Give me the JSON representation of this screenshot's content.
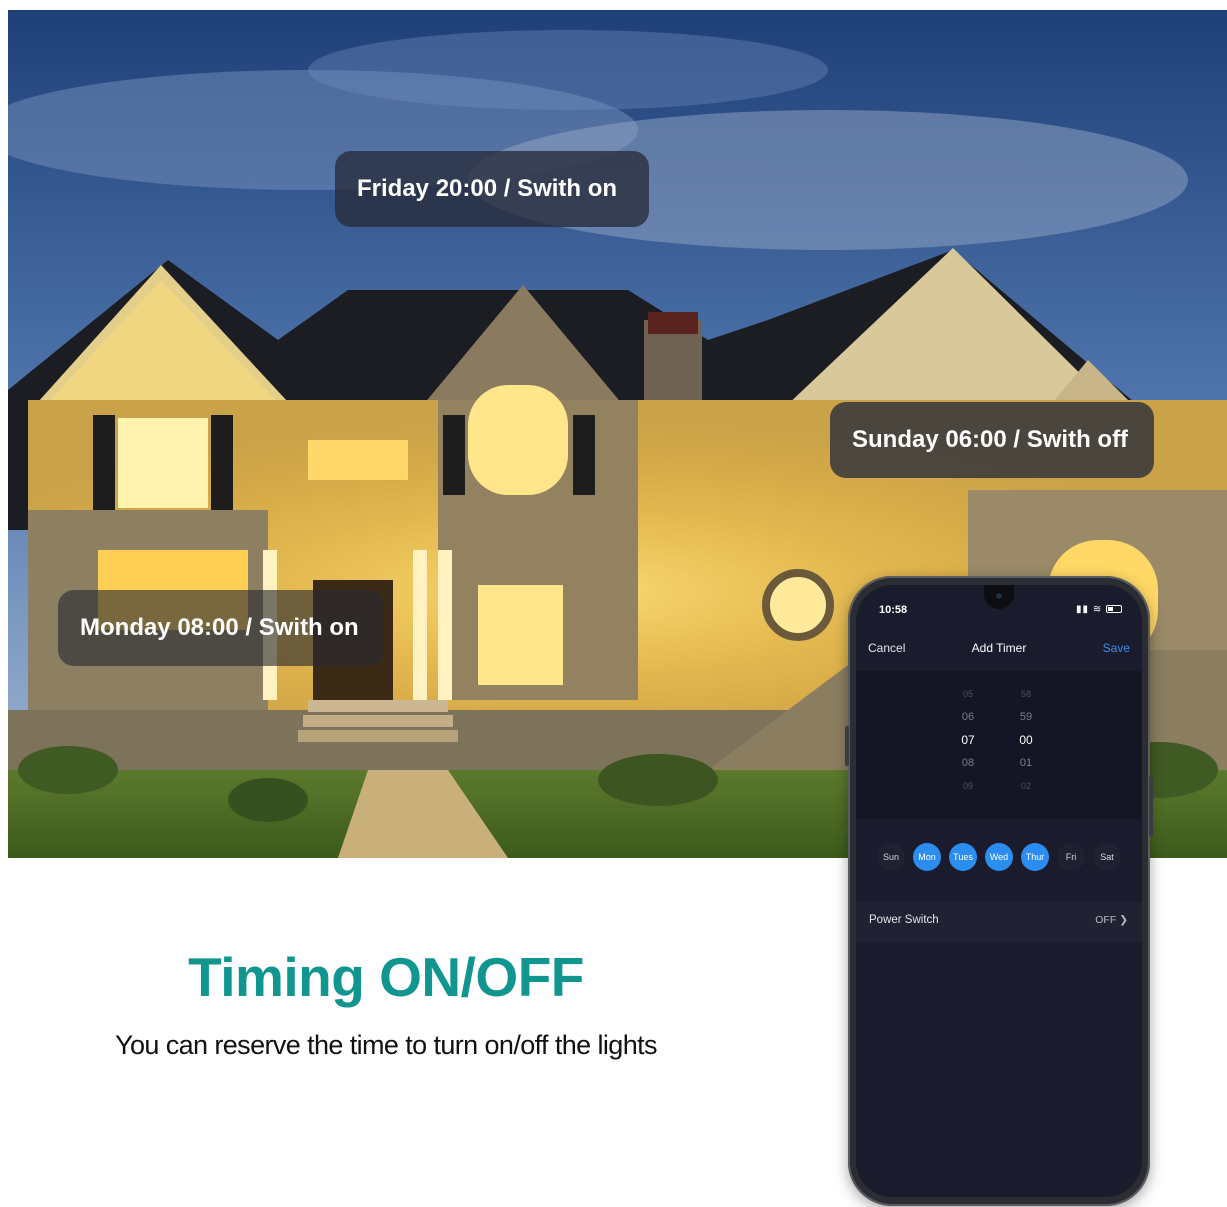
{
  "overlay_labels": {
    "friday": "Friday 20:00 / Swith on",
    "sunday": "Sunday 06:00 / Swith off",
    "monday": "Monday 08:00 / Swith on"
  },
  "headline": "Timing ON/OFF",
  "subline": "You can reserve the time to turn on/off the lights",
  "phone": {
    "status_time": "10:58",
    "nav": {
      "cancel": "Cancel",
      "title": "Add Timer",
      "save": "Save"
    },
    "picker": {
      "hours": [
        "05",
        "06",
        "07",
        "08",
        "09"
      ],
      "minutes": [
        "58",
        "59",
        "00",
        "01",
        "02"
      ],
      "selected_hour": "07",
      "selected_minute": "00"
    },
    "days": [
      {
        "label": "Sun",
        "selected": false
      },
      {
        "label": "Mon",
        "selected": true
      },
      {
        "label": "Tues",
        "selected": true
      },
      {
        "label": "Wed",
        "selected": true
      },
      {
        "label": "Thur",
        "selected": true
      },
      {
        "label": "Fri",
        "selected": false
      },
      {
        "label": "Sat",
        "selected": false
      }
    ],
    "power_switch": {
      "label": "Power Switch",
      "value": "OFF",
      "chevron": "chevron-right-icon"
    }
  },
  "colors": {
    "headline": "#11968f",
    "accent_blue": "#2c8df0",
    "screen_bg": "#1a1b2c"
  }
}
